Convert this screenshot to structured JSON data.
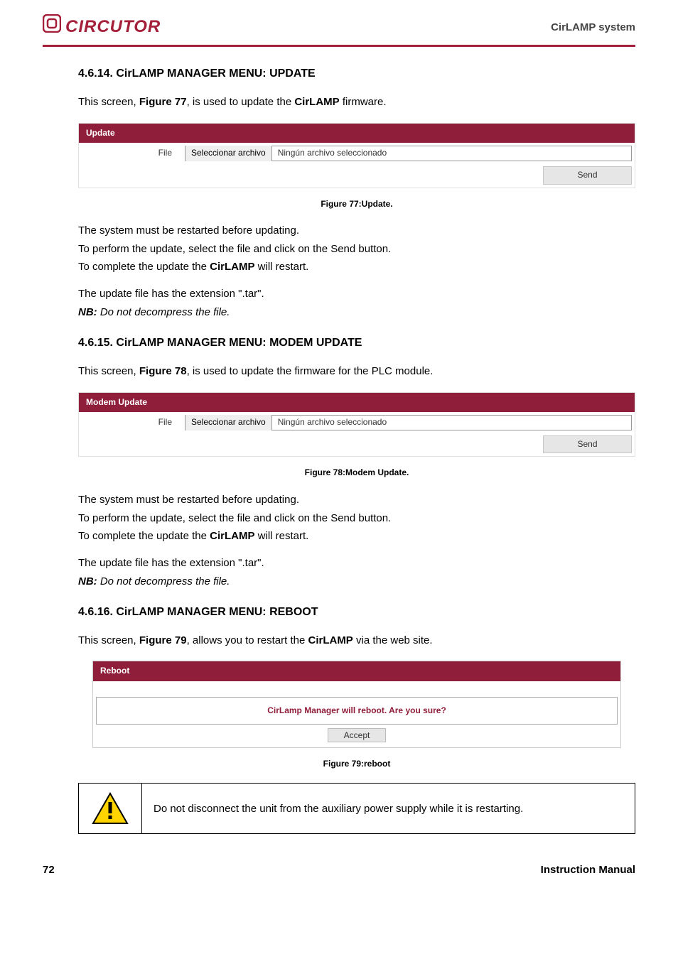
{
  "header": {
    "brand": "CIRCUTOR",
    "system": "CirLAMP system"
  },
  "sections": {
    "s1": {
      "title": "4.6.14. CirLAMP MANAGER MENU: UPDATE",
      "intro_pre": "This screen, ",
      "intro_fig": "Figure 77",
      "intro_mid": ", is used to update the ",
      "intro_strong": "CirLAMP",
      "intro_post": " firmware.",
      "panel_title": "Update",
      "file_label": "File",
      "file_button": "Seleccionar archivo",
      "file_status": "Ningún archivo seleccionado",
      "send": "Send",
      "caption": "Figure 77:Update.",
      "body1": "The system must be restarted before updating.",
      "body2": "To perform the update, select the file and click on the Send button.",
      "body3_pre": "To complete the update the ",
      "body3_strong": "CirLAMP",
      "body3_post": " will restart.",
      "body4": "The update file has the extension \".tar\".",
      "nb_label": "NB:",
      "nb_text": " Do not decompress the file."
    },
    "s2": {
      "title": "4.6.15. CirLAMP MANAGER MENU: MODEM UPDATE",
      "intro_pre": "This screen, ",
      "intro_fig": "Figure 78",
      "intro_post": ", is used to update the firmware for the PLC module.",
      "panel_title": "Modem Update",
      "file_label": "File",
      "file_button": "Seleccionar archivo",
      "file_status": "Ningún archivo seleccionado",
      "send": "Send",
      "caption": "Figure 78:Modem Update.",
      "body1": "The system must be restarted before updating.",
      "body2": "To perform the update, select the file and click on the Send button.",
      "body3_pre": "To complete the update the ",
      "body3_strong": "CirLAMP",
      "body3_post": " will restart.",
      "body4": "The update file has the extension \".tar\".",
      "nb_label": "NB:",
      "nb_text": " Do not decompress the file."
    },
    "s3": {
      "title": "4.6.16. CirLAMP MANAGER MENU: REBOOT",
      "intro_pre": "This screen, ",
      "intro_fig": "Figure 79",
      "intro_mid": ", allows you to restart the ",
      "intro_strong": "CirLAMP",
      "intro_post": " via the web site.",
      "panel_title": "Reboot",
      "warn_text": "CirLamp Manager will reboot. Are you sure?",
      "accept": "Accept",
      "caption": "Figure 79:reboot",
      "warning_box": "Do not disconnect the unit from the auxiliary power supply while it is restarting."
    }
  },
  "footer": {
    "page": "72",
    "label": "Instruction Manual"
  }
}
